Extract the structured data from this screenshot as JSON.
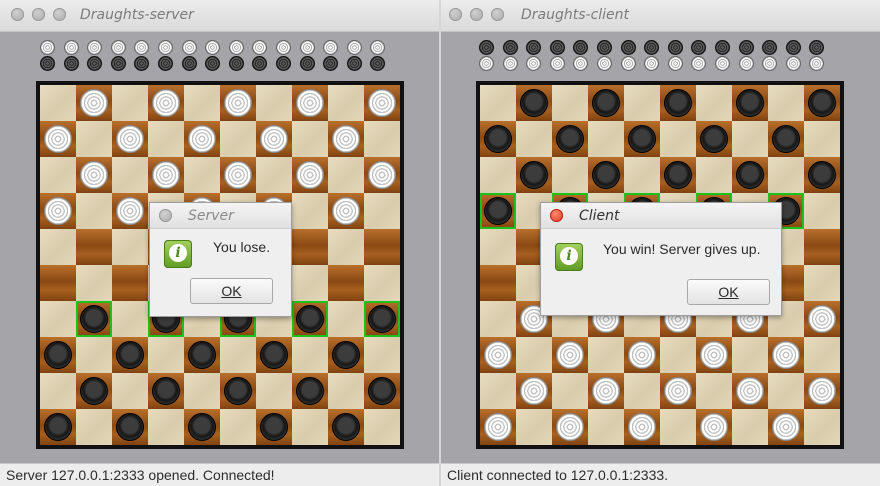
{
  "server_window": {
    "title": "Draughts-server",
    "status": "Server 127.0.0.1:2333 opened. Connected!",
    "tray": {
      "rows": [
        {
          "color": "white",
          "count": 15
        },
        {
          "color": "black",
          "count": 15
        }
      ]
    },
    "board": {
      "pieces": [
        ".w.w.w.w.w",
        "w.w.w.w.w.",
        ".w.w.w.w.w",
        "w.w.w.w.w.",
        "..........",
        "..........",
        ".b.b.b.b.b",
        "b.b.b.b.b.",
        ".b.b.b.b.b",
        "b.b.b.b.b."
      ],
      "highlighted": [
        [
          6,
          1
        ],
        [
          6,
          3
        ],
        [
          6,
          5
        ],
        [
          6,
          7
        ],
        [
          6,
          9
        ]
      ]
    },
    "dialog": {
      "title": "Server",
      "message": "You lose.",
      "ok_label": "OK",
      "icon": "info-icon"
    }
  },
  "client_window": {
    "title": "Draughts-client",
    "status": "Client connected to 127.0.0.1:2333.",
    "tray": {
      "rows": [
        {
          "color": "black",
          "count": 15
        },
        {
          "color": "white",
          "count": 15
        }
      ]
    },
    "board": {
      "pieces": [
        ".b.b.b.b.b",
        "b.b.b.b.b.",
        ".b.b.b.b.b",
        "b.b.b.b.b.",
        "..........",
        "..........",
        ".w.w.w.w.w",
        "w.w.w.w.w.",
        ".w.w.w.w.w",
        "w.w.w.w.w."
      ],
      "highlighted": [
        [
          3,
          0
        ],
        [
          3,
          2
        ],
        [
          3,
          4
        ],
        [
          3,
          6
        ],
        [
          3,
          8
        ]
      ]
    },
    "dialog": {
      "title": "Client",
      "message": "You win! Server gives up.",
      "ok_label": "OK",
      "icon": "info-icon"
    }
  },
  "colors": {
    "highlight": "#1cc21c",
    "close_active": "#e0301e"
  }
}
